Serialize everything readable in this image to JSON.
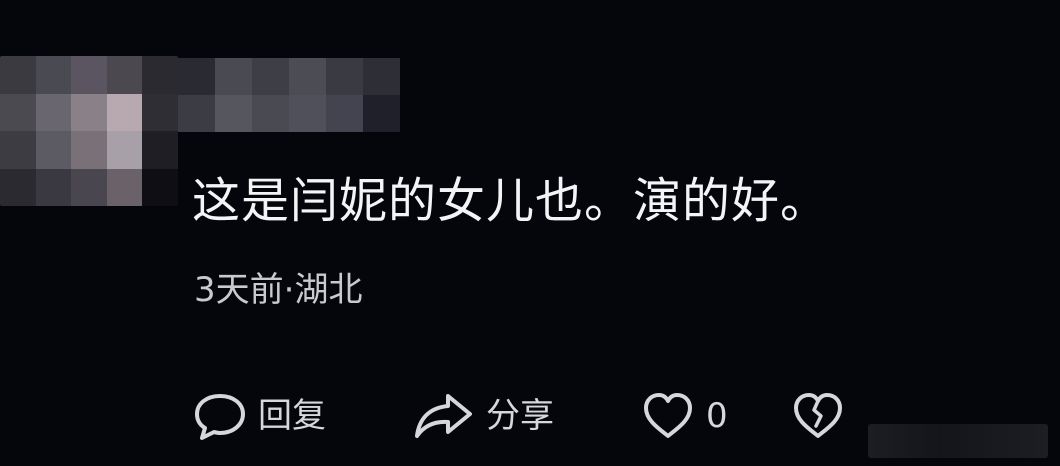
{
  "comment": {
    "text": "这是闫妮的女儿也。演的好。",
    "meta": "3天前·湖北"
  },
  "actions": {
    "reply": {
      "icon": "chat-bubble-icon",
      "label": "回复"
    },
    "share": {
      "icon": "share-arrow-icon",
      "label": "分享"
    },
    "like": {
      "icon": "heart-icon",
      "count": "0"
    },
    "dislike": {
      "icon": "broken-heart-icon"
    }
  },
  "colors": {
    "background": "#04060b",
    "text": "#f4f4f6",
    "meta": "#c9c9cf",
    "icon": "#d6d6dc"
  }
}
